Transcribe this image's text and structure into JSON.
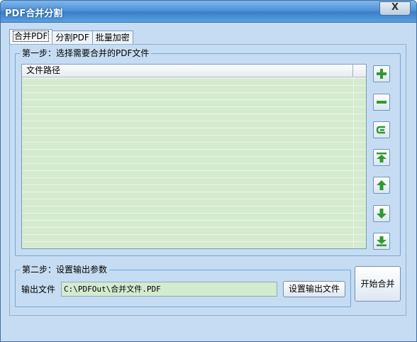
{
  "window": {
    "title": "PDF合并分割",
    "close_symbol": "X"
  },
  "tabs": [
    {
      "label": "合并PDF",
      "active": true
    },
    {
      "label": "分割PDF",
      "active": false
    },
    {
      "label": "批量加密",
      "active": false
    }
  ],
  "step1": {
    "legend": "第一步：选择需要合并的PDF文件",
    "list": {
      "column_header": "文件路径",
      "rows": []
    },
    "buttons": [
      {
        "icon": "add-icon"
      },
      {
        "icon": "remove-icon"
      },
      {
        "icon": "clear-icon"
      },
      {
        "icon": "move-top-icon"
      },
      {
        "icon": "move-up-icon"
      },
      {
        "icon": "move-down-icon"
      },
      {
        "icon": "move-bottom-icon"
      }
    ]
  },
  "step2": {
    "legend": "第二步：设置输出参数",
    "output_label": "输出文件",
    "output_path": "C:\\PDFOut\\合并文件.PDF",
    "set_output_button": "设置输出文件"
  },
  "start_button": "开始合并",
  "colors": {
    "window_bg": "#c6dcf2",
    "titlebar": "#4f93d8",
    "list_bg": "#d5ebcf",
    "icon_green": "#2f9a2f"
  }
}
